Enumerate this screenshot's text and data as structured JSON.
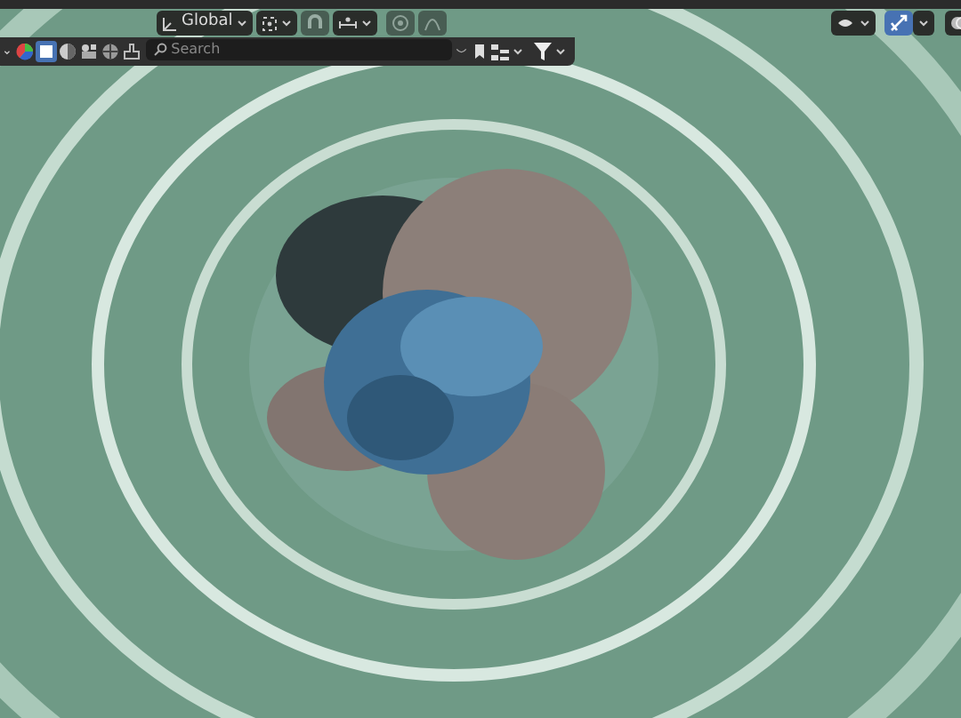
{
  "header": {
    "orientation": "Global",
    "snap_active": false,
    "proportional_active": false,
    "gizmo_active": true
  },
  "outliner_bar": {
    "filters": [
      {
        "kind": "color",
        "selected": false
      },
      {
        "kind": "square",
        "selected": true
      },
      {
        "kind": "sphere",
        "selected": false
      },
      {
        "kind": "figure",
        "selected": false
      },
      {
        "kind": "globe",
        "selected": false
      },
      {
        "kind": "stamp",
        "selected": false
      }
    ],
    "search": {
      "placeholder": "Search"
    }
  }
}
